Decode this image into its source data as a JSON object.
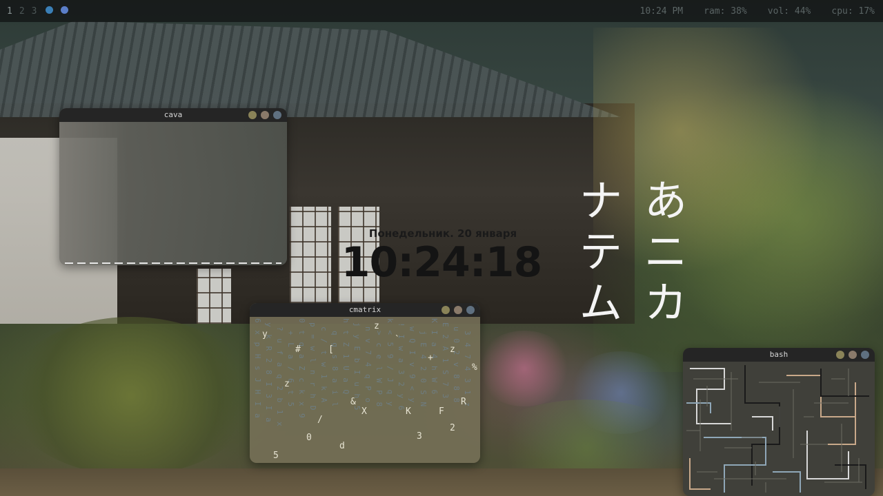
{
  "topbar": {
    "workspaces": [
      "1",
      "2",
      "3"
    ],
    "active_workspace": "1",
    "time": "10:24 PM",
    "ram": "ram: 38%",
    "vol": "vol: 44%",
    "cpu": "cpu: 17%",
    "tray_icons": [
      "steam-icon",
      "discord-icon"
    ]
  },
  "windows": {
    "cava": {
      "title": "cava"
    },
    "cmatrix": {
      "title": "cmatrix",
      "highlighted_chars": [
        "z",
        "y",
        "`",
        "+",
        "z",
        "#",
        "[",
        "%",
        "z",
        "&",
        "X",
        "K",
        "F",
        "R",
        "/",
        "0",
        "3",
        "2",
        "d",
        "5"
      ],
      "columns": [
        "6 x p H s J H I a",
        "y k R 2 8 I 3 I a",
        "? u f a q 2 b 1 x",
        "+ L a / 6 t 5",
        "0 t q a Z c k x 9",
        "p = w l n r h D",
        "c / t w 1 k A",
        "q g s 8 a i l",
        "h t Z 1 U a Q",
        "j y E b I u h 5",
        "n v 7 4 q P o",
        "> c e l W P 8",
        "k < 5 9 / J q y",
        "! I w a 3 2 y 6",
        "w Q I v 9 < y",
        "j E 4 2 0 S N",
        "K I a 4 h W 6",
        "E 2 A 1 S 7 3",
        "u 0 2 v 8 8 8",
        "3 4 7 4 3 1 z"
      ]
    },
    "bash": {
      "title": "bash"
    }
  },
  "clock": {
    "date": "Понедельник. 20 января",
    "time": "10:24:18"
  },
  "kana": {
    "col1": [
      "あ",
      "ニ",
      "カ"
    ],
    "col2": [
      "ナ",
      "テ",
      "ム"
    ]
  },
  "colors": {
    "titlebar": "#252525",
    "btn_yellow": "#8a8358",
    "btn_brown": "#8a7a6a",
    "btn_blue": "#5f7080"
  }
}
